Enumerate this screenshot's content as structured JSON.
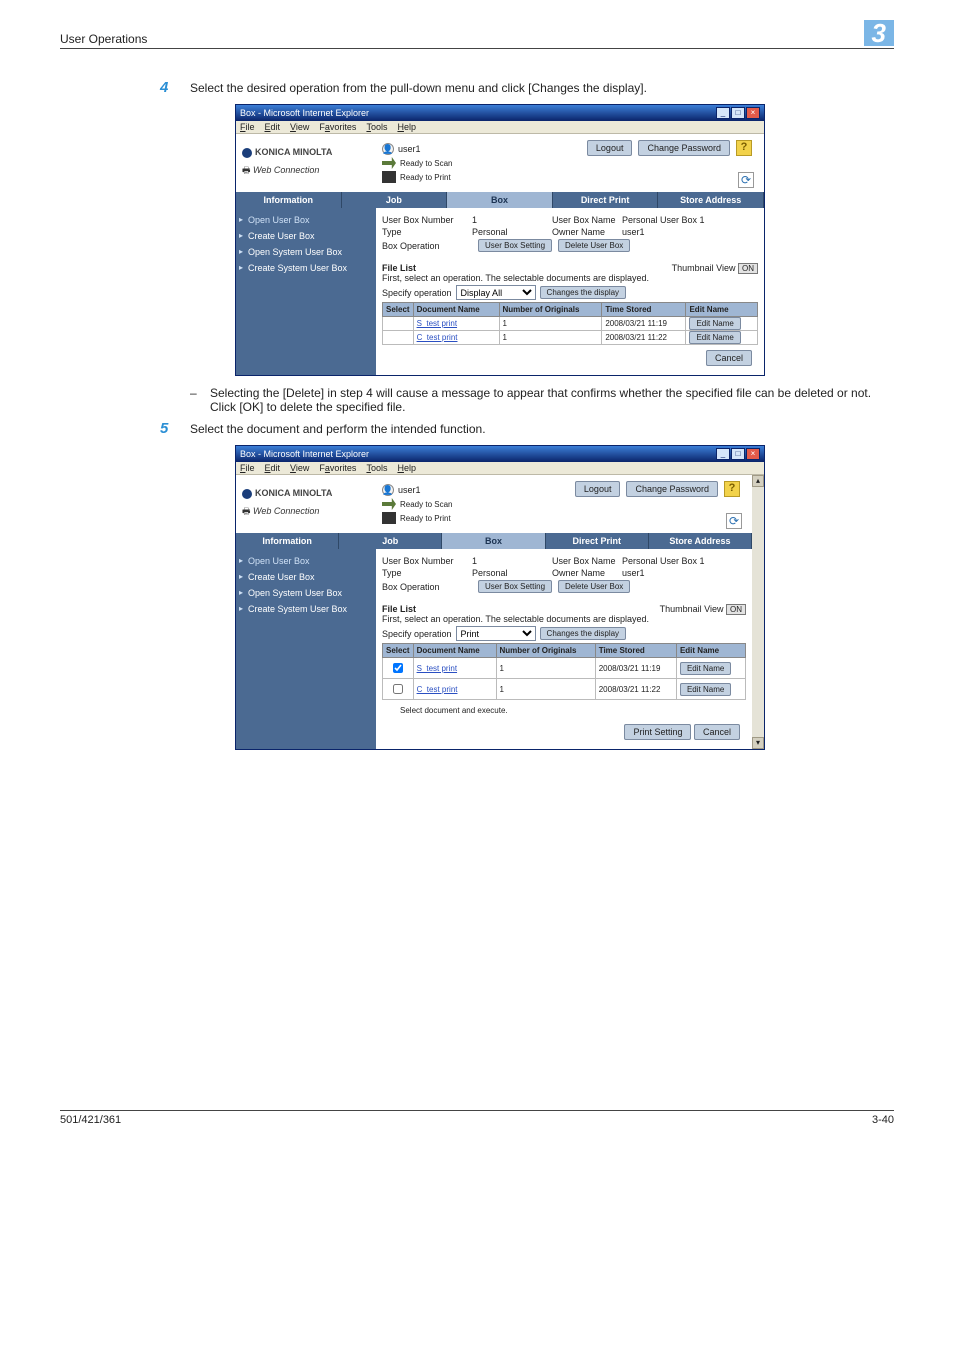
{
  "header": {
    "section_title": "User Operations",
    "chapter": "3"
  },
  "steps": {
    "s4": {
      "num": "4",
      "text": "Select the desired operation from the pull-down menu and click [Changes the display]."
    },
    "s5": {
      "num": "5",
      "text": "Select the document and perform the intended function."
    }
  },
  "note": "Selecting the [Delete] in step 4 will cause a message to appear that confirms whether the specified file can be deleted or not. Click [OK] to delete the specified file.",
  "win": {
    "title": "Box - Microsoft Internet Explorer",
    "menu": {
      "file": "File",
      "edit": "Edit",
      "view": "View",
      "favorites": "Favorites",
      "tools": "Tools",
      "help": "Help"
    },
    "brand": "KONICA MINOLTA",
    "pagescope": "Web Connection",
    "user": "user1",
    "status_scan": "Ready to Scan",
    "status_print": "Ready to Print",
    "btn_logout": "Logout",
    "btn_changepw": "Change Password",
    "help_q": "?",
    "refresh": "⟳",
    "tabs": {
      "info": "Information",
      "job": "Job",
      "box": "Box",
      "direct": "Direct Print",
      "store": "Store Address"
    },
    "leftnav": {
      "open_user": "Open User Box",
      "create_user": "Create User Box",
      "open_sys": "Open System User Box",
      "create_sys": "Create System User Box"
    },
    "kv": {
      "ubn_k": "User Box Number",
      "ubn_v": "1",
      "type_k": "Type",
      "type_v": "Personal",
      "boxop_k": "Box Operation",
      "ubname_k": "User Box Name",
      "ubname_v": "Personal User Box 1",
      "owner_k": "Owner Name",
      "owner_v": "user1"
    },
    "btn_userbox_setting": "User Box Setting",
    "btn_delete_userbox": "Delete User Box",
    "filelist_heading": "File List",
    "thumbnail_label": "Thumbnail View",
    "thumbnail_state": "ON",
    "first_select": "First, select an operation. The selectable documents are displayed.",
    "specify_label": "Specify operation",
    "btn_changes_display": "Changes the display",
    "table": {
      "h_select": "Select",
      "h_docname": "Document Name",
      "h_num": "Number of Originals",
      "h_time": "Time Stored",
      "h_edit": "Edit Name",
      "rows": [
        {
          "name": "S_test print",
          "num": "1",
          "time": "2008/03/21 11:19",
          "edit": "Edit Name"
        },
        {
          "name": "C_test print",
          "num": "1",
          "time": "2008/03/21 11:22",
          "edit": "Edit Name"
        }
      ]
    },
    "btn_cancel": "Cancel"
  },
  "shot1": {
    "specify_value": "Display All"
  },
  "shot2": {
    "specify_value": "Print",
    "select_execute": "Select document and execute.",
    "btn_print_setting": "Print Setting"
  },
  "footer": {
    "left": "501/421/361",
    "right": "3-40"
  }
}
